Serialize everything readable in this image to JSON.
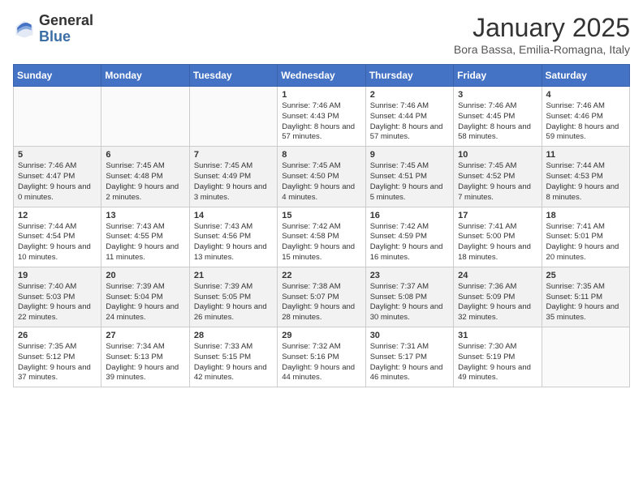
{
  "header": {
    "logo_general": "General",
    "logo_blue": "Blue",
    "month_title": "January 2025",
    "location": "Bora Bassa, Emilia-Romagna, Italy"
  },
  "weekdays": [
    "Sunday",
    "Monday",
    "Tuesday",
    "Wednesday",
    "Thursday",
    "Friday",
    "Saturday"
  ],
  "weeks": [
    [
      {
        "day": "",
        "info": ""
      },
      {
        "day": "",
        "info": ""
      },
      {
        "day": "",
        "info": ""
      },
      {
        "day": "1",
        "info": "Sunrise: 7:46 AM\nSunset: 4:43 PM\nDaylight: 8 hours\nand 57 minutes."
      },
      {
        "day": "2",
        "info": "Sunrise: 7:46 AM\nSunset: 4:44 PM\nDaylight: 8 hours\nand 57 minutes."
      },
      {
        "day": "3",
        "info": "Sunrise: 7:46 AM\nSunset: 4:45 PM\nDaylight: 8 hours\nand 58 minutes."
      },
      {
        "day": "4",
        "info": "Sunrise: 7:46 AM\nSunset: 4:46 PM\nDaylight: 8 hours\nand 59 minutes."
      }
    ],
    [
      {
        "day": "5",
        "info": "Sunrise: 7:46 AM\nSunset: 4:47 PM\nDaylight: 9 hours\nand 0 minutes."
      },
      {
        "day": "6",
        "info": "Sunrise: 7:45 AM\nSunset: 4:48 PM\nDaylight: 9 hours\nand 2 minutes."
      },
      {
        "day": "7",
        "info": "Sunrise: 7:45 AM\nSunset: 4:49 PM\nDaylight: 9 hours\nand 3 minutes."
      },
      {
        "day": "8",
        "info": "Sunrise: 7:45 AM\nSunset: 4:50 PM\nDaylight: 9 hours\nand 4 minutes."
      },
      {
        "day": "9",
        "info": "Sunrise: 7:45 AM\nSunset: 4:51 PM\nDaylight: 9 hours\nand 5 minutes."
      },
      {
        "day": "10",
        "info": "Sunrise: 7:45 AM\nSunset: 4:52 PM\nDaylight: 9 hours\nand 7 minutes."
      },
      {
        "day": "11",
        "info": "Sunrise: 7:44 AM\nSunset: 4:53 PM\nDaylight: 9 hours\nand 8 minutes."
      }
    ],
    [
      {
        "day": "12",
        "info": "Sunrise: 7:44 AM\nSunset: 4:54 PM\nDaylight: 9 hours\nand 10 minutes."
      },
      {
        "day": "13",
        "info": "Sunrise: 7:43 AM\nSunset: 4:55 PM\nDaylight: 9 hours\nand 11 minutes."
      },
      {
        "day": "14",
        "info": "Sunrise: 7:43 AM\nSunset: 4:56 PM\nDaylight: 9 hours\nand 13 minutes."
      },
      {
        "day": "15",
        "info": "Sunrise: 7:42 AM\nSunset: 4:58 PM\nDaylight: 9 hours\nand 15 minutes."
      },
      {
        "day": "16",
        "info": "Sunrise: 7:42 AM\nSunset: 4:59 PM\nDaylight: 9 hours\nand 16 minutes."
      },
      {
        "day": "17",
        "info": "Sunrise: 7:41 AM\nSunset: 5:00 PM\nDaylight: 9 hours\nand 18 minutes."
      },
      {
        "day": "18",
        "info": "Sunrise: 7:41 AM\nSunset: 5:01 PM\nDaylight: 9 hours\nand 20 minutes."
      }
    ],
    [
      {
        "day": "19",
        "info": "Sunrise: 7:40 AM\nSunset: 5:03 PM\nDaylight: 9 hours\nand 22 minutes."
      },
      {
        "day": "20",
        "info": "Sunrise: 7:39 AM\nSunset: 5:04 PM\nDaylight: 9 hours\nand 24 minutes."
      },
      {
        "day": "21",
        "info": "Sunrise: 7:39 AM\nSunset: 5:05 PM\nDaylight: 9 hours\nand 26 minutes."
      },
      {
        "day": "22",
        "info": "Sunrise: 7:38 AM\nSunset: 5:07 PM\nDaylight: 9 hours\nand 28 minutes."
      },
      {
        "day": "23",
        "info": "Sunrise: 7:37 AM\nSunset: 5:08 PM\nDaylight: 9 hours\nand 30 minutes."
      },
      {
        "day": "24",
        "info": "Sunrise: 7:36 AM\nSunset: 5:09 PM\nDaylight: 9 hours\nand 32 minutes."
      },
      {
        "day": "25",
        "info": "Sunrise: 7:35 AM\nSunset: 5:11 PM\nDaylight: 9 hours\nand 35 minutes."
      }
    ],
    [
      {
        "day": "26",
        "info": "Sunrise: 7:35 AM\nSunset: 5:12 PM\nDaylight: 9 hours\nand 37 minutes."
      },
      {
        "day": "27",
        "info": "Sunrise: 7:34 AM\nSunset: 5:13 PM\nDaylight: 9 hours\nand 39 minutes."
      },
      {
        "day": "28",
        "info": "Sunrise: 7:33 AM\nSunset: 5:15 PM\nDaylight: 9 hours\nand 42 minutes."
      },
      {
        "day": "29",
        "info": "Sunrise: 7:32 AM\nSunset: 5:16 PM\nDaylight: 9 hours\nand 44 minutes."
      },
      {
        "day": "30",
        "info": "Sunrise: 7:31 AM\nSunset: 5:17 PM\nDaylight: 9 hours\nand 46 minutes."
      },
      {
        "day": "31",
        "info": "Sunrise: 7:30 AM\nSunset: 5:19 PM\nDaylight: 9 hours\nand 49 minutes."
      },
      {
        "day": "",
        "info": ""
      }
    ]
  ]
}
